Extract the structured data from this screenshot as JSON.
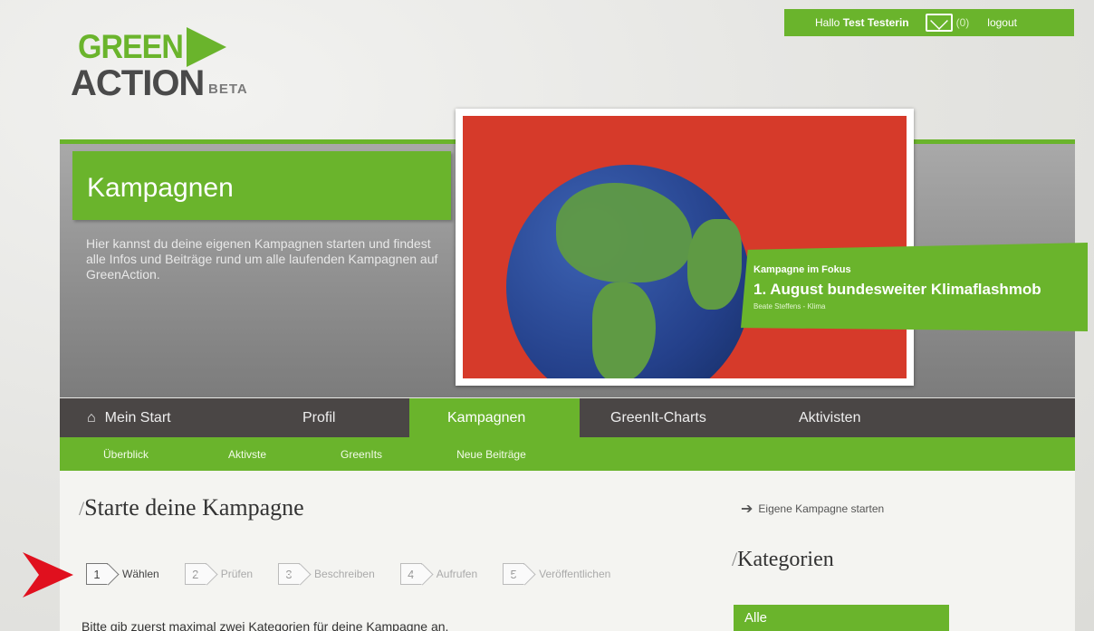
{
  "header": {
    "hello": "Hallo",
    "user": "Test Testerin",
    "message_count": "(0)",
    "logout": "logout"
  },
  "logo": {
    "line1": "GREEN",
    "line2": "ACTION",
    "beta": "BETA"
  },
  "hero": {
    "title": "Kampagnen",
    "text": "Hier kannst du deine eigenen Kampagnen starten und findest alle Infos und Beiträge rund um alle laufenden Kampagnen auf GreenAction."
  },
  "focus": {
    "kicker": "Kampagne im Fokus",
    "headline": "1. August bundesweiter Klimaflashmob",
    "byline": "Beate Steffens - Klima"
  },
  "main_nav": [
    {
      "label": "Mein Start",
      "icon": "home-icon"
    },
    {
      "label": "Profil"
    },
    {
      "label": "Kampagnen",
      "active": true
    },
    {
      "label": "GreenIt-Charts"
    },
    {
      "label": "Aktivisten"
    }
  ],
  "sub_nav": [
    "Überblick",
    "Aktivste",
    "GreenIts",
    "Neue Beiträge"
  ],
  "content": {
    "heading": "Starte deine Kampagne",
    "intro": "Bitte gib zuerst maximal zwei Kategorien für deine Kampagne an."
  },
  "steps": [
    {
      "num": "1",
      "label": "Wählen",
      "current": true
    },
    {
      "num": "2",
      "label": "Prüfen"
    },
    {
      "num": "3",
      "label": "Beschreiben"
    },
    {
      "num": "4",
      "label": "Aufrufen"
    },
    {
      "num": "5",
      "label": "Veröffentlichen"
    }
  ],
  "sidebar": {
    "own_campaign": "Eigene Kampagne starten",
    "categories_heading": "Kategorien",
    "first_category": "Alle"
  },
  "colors": {
    "green": "#6ab42c",
    "nav_dark": "#4a4645",
    "pointer_red": "#e0101e"
  }
}
